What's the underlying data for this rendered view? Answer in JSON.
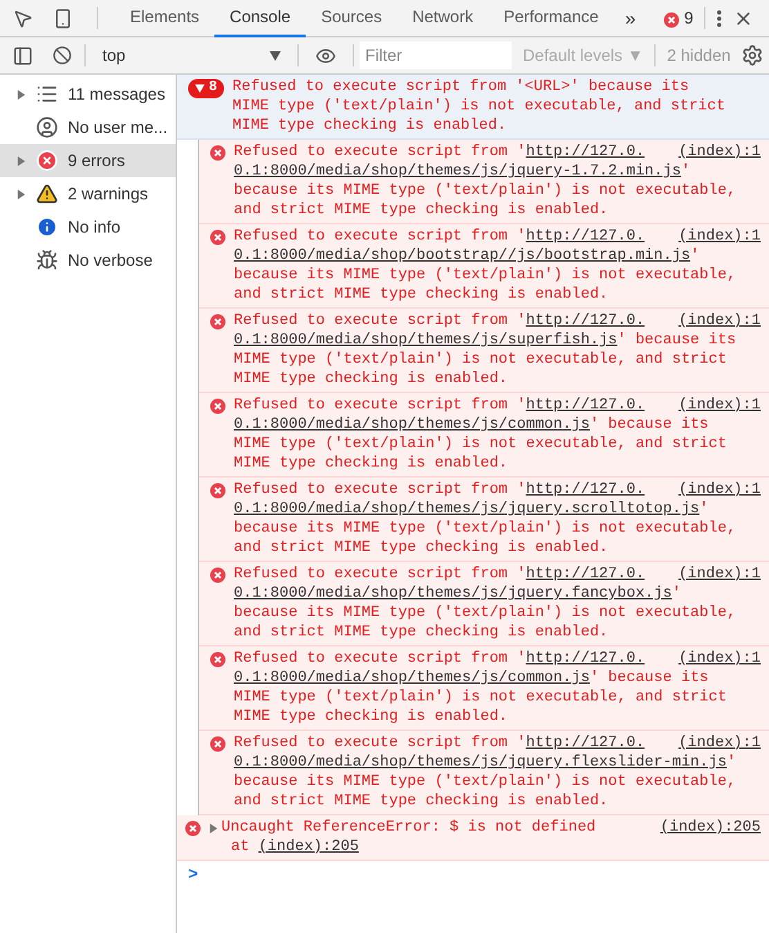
{
  "toolbar": {
    "tabs": [
      {
        "label": "Elements",
        "selected": false
      },
      {
        "label": "Console",
        "selected": true
      },
      {
        "label": "Sources",
        "selected": false
      },
      {
        "label": "Network",
        "selected": false
      },
      {
        "label": "Performance",
        "selected": false
      }
    ],
    "more": "»",
    "error_count": "9"
  },
  "console_bar": {
    "context": "top",
    "filter": {
      "placeholder": "Filter"
    },
    "levels": "Default levels ▼",
    "hidden": "2 hidden"
  },
  "sidebar": {
    "items": [
      {
        "kind": "list",
        "label": "11 messages",
        "expandable": true,
        "selected": false
      },
      {
        "kind": "user",
        "label": "No user me...",
        "expandable": false,
        "selected": false
      },
      {
        "kind": "error",
        "label": "9 errors",
        "expandable": true,
        "selected": true
      },
      {
        "kind": "warning",
        "label": "2 warnings",
        "expandable": true,
        "selected": false
      },
      {
        "kind": "info",
        "label": "No info",
        "expandable": false,
        "selected": false
      },
      {
        "kind": "verbose",
        "label": "No verbose",
        "expandable": false,
        "selected": false
      }
    ]
  },
  "group": {
    "count": "8",
    "expanded": true,
    "lines": [
      "Refused to execute script from '<URL>' because its",
      "MIME type ('text/plain') is not executable, and strict",
      "MIME type checking is enabled."
    ]
  },
  "messages": [
    {
      "prefix": "Refused to execute script from '",
      "url_line1": "http://127.0.",
      "source": "(index):1",
      "url_line2": "0.1:8000/media/shop/themes/js/jquery-1.7.2.min.js",
      "after_url": "'",
      "lines": [
        "because its MIME type ('text/plain') is not executable,",
        "and strict MIME type checking is enabled."
      ]
    },
    {
      "prefix": "Refused to execute script from '",
      "url_line1": "http://127.0.",
      "source": "(index):1",
      "url_line2": "0.1:8000/media/shop/bootstrap//js/bootstrap.min.js",
      "after_url": "'",
      "lines": [
        "because its MIME type ('text/plain') is not executable,",
        "and strict MIME type checking is enabled."
      ]
    },
    {
      "prefix": "Refused to execute script from '",
      "url_line1": "http://127.0.",
      "source": "(index):1",
      "url_line2": "0.1:8000/media/shop/themes/js/superfish.js",
      "after_url": "' because its",
      "lines": [
        "MIME type ('text/plain') is not executable, and strict",
        "MIME type checking is enabled."
      ]
    },
    {
      "prefix": "Refused to execute script from '",
      "url_line1": "http://127.0.",
      "source": "(index):1",
      "url_line2": "0.1:8000/media/shop/themes/js/common.js",
      "after_url": "' because its",
      "lines": [
        "MIME type ('text/plain') is not executable, and strict",
        "MIME type checking is enabled."
      ]
    },
    {
      "prefix": "Refused to execute script from '",
      "url_line1": "http://127.0.",
      "source": "(index):1",
      "url_line2": "0.1:8000/media/shop/themes/js/jquery.scrolltotop.js",
      "after_url": "'",
      "lines": [
        "because its MIME type ('text/plain') is not executable,",
        "and strict MIME type checking is enabled."
      ]
    },
    {
      "prefix": "Refused to execute script from '",
      "url_line1": "http://127.0.",
      "source": "(index):1",
      "url_line2": "0.1:8000/media/shop/themes/js/jquery.fancybox.js",
      "after_url": "'",
      "lines": [
        "because its MIME type ('text/plain') is not executable,",
        "and strict MIME type checking is enabled."
      ]
    },
    {
      "prefix": "Refused to execute script from '",
      "url_line1": "http://127.0.",
      "source": "(index):1",
      "url_line2": "0.1:8000/media/shop/themes/js/common.js",
      "after_url": "' because its",
      "lines": [
        "MIME type ('text/plain') is not executable, and strict",
        "MIME type checking is enabled."
      ]
    },
    {
      "prefix": "Refused to execute script from '",
      "url_line1": "http://127.0.",
      "source": "(index):1",
      "url_line2": "0.1:8000/media/shop/themes/js/jquery.flexslider-min.js",
      "after_url": "'",
      "lines": [
        "because its MIME type ('text/plain') is not executable,",
        "and strict MIME type checking is enabled."
      ]
    }
  ],
  "exception": {
    "expanded": false,
    "text": "Uncaught ReferenceError: $ is not defined",
    "source": "(index):205",
    "at": "at",
    "at_link": "(index):205"
  },
  "prompt": ">"
}
